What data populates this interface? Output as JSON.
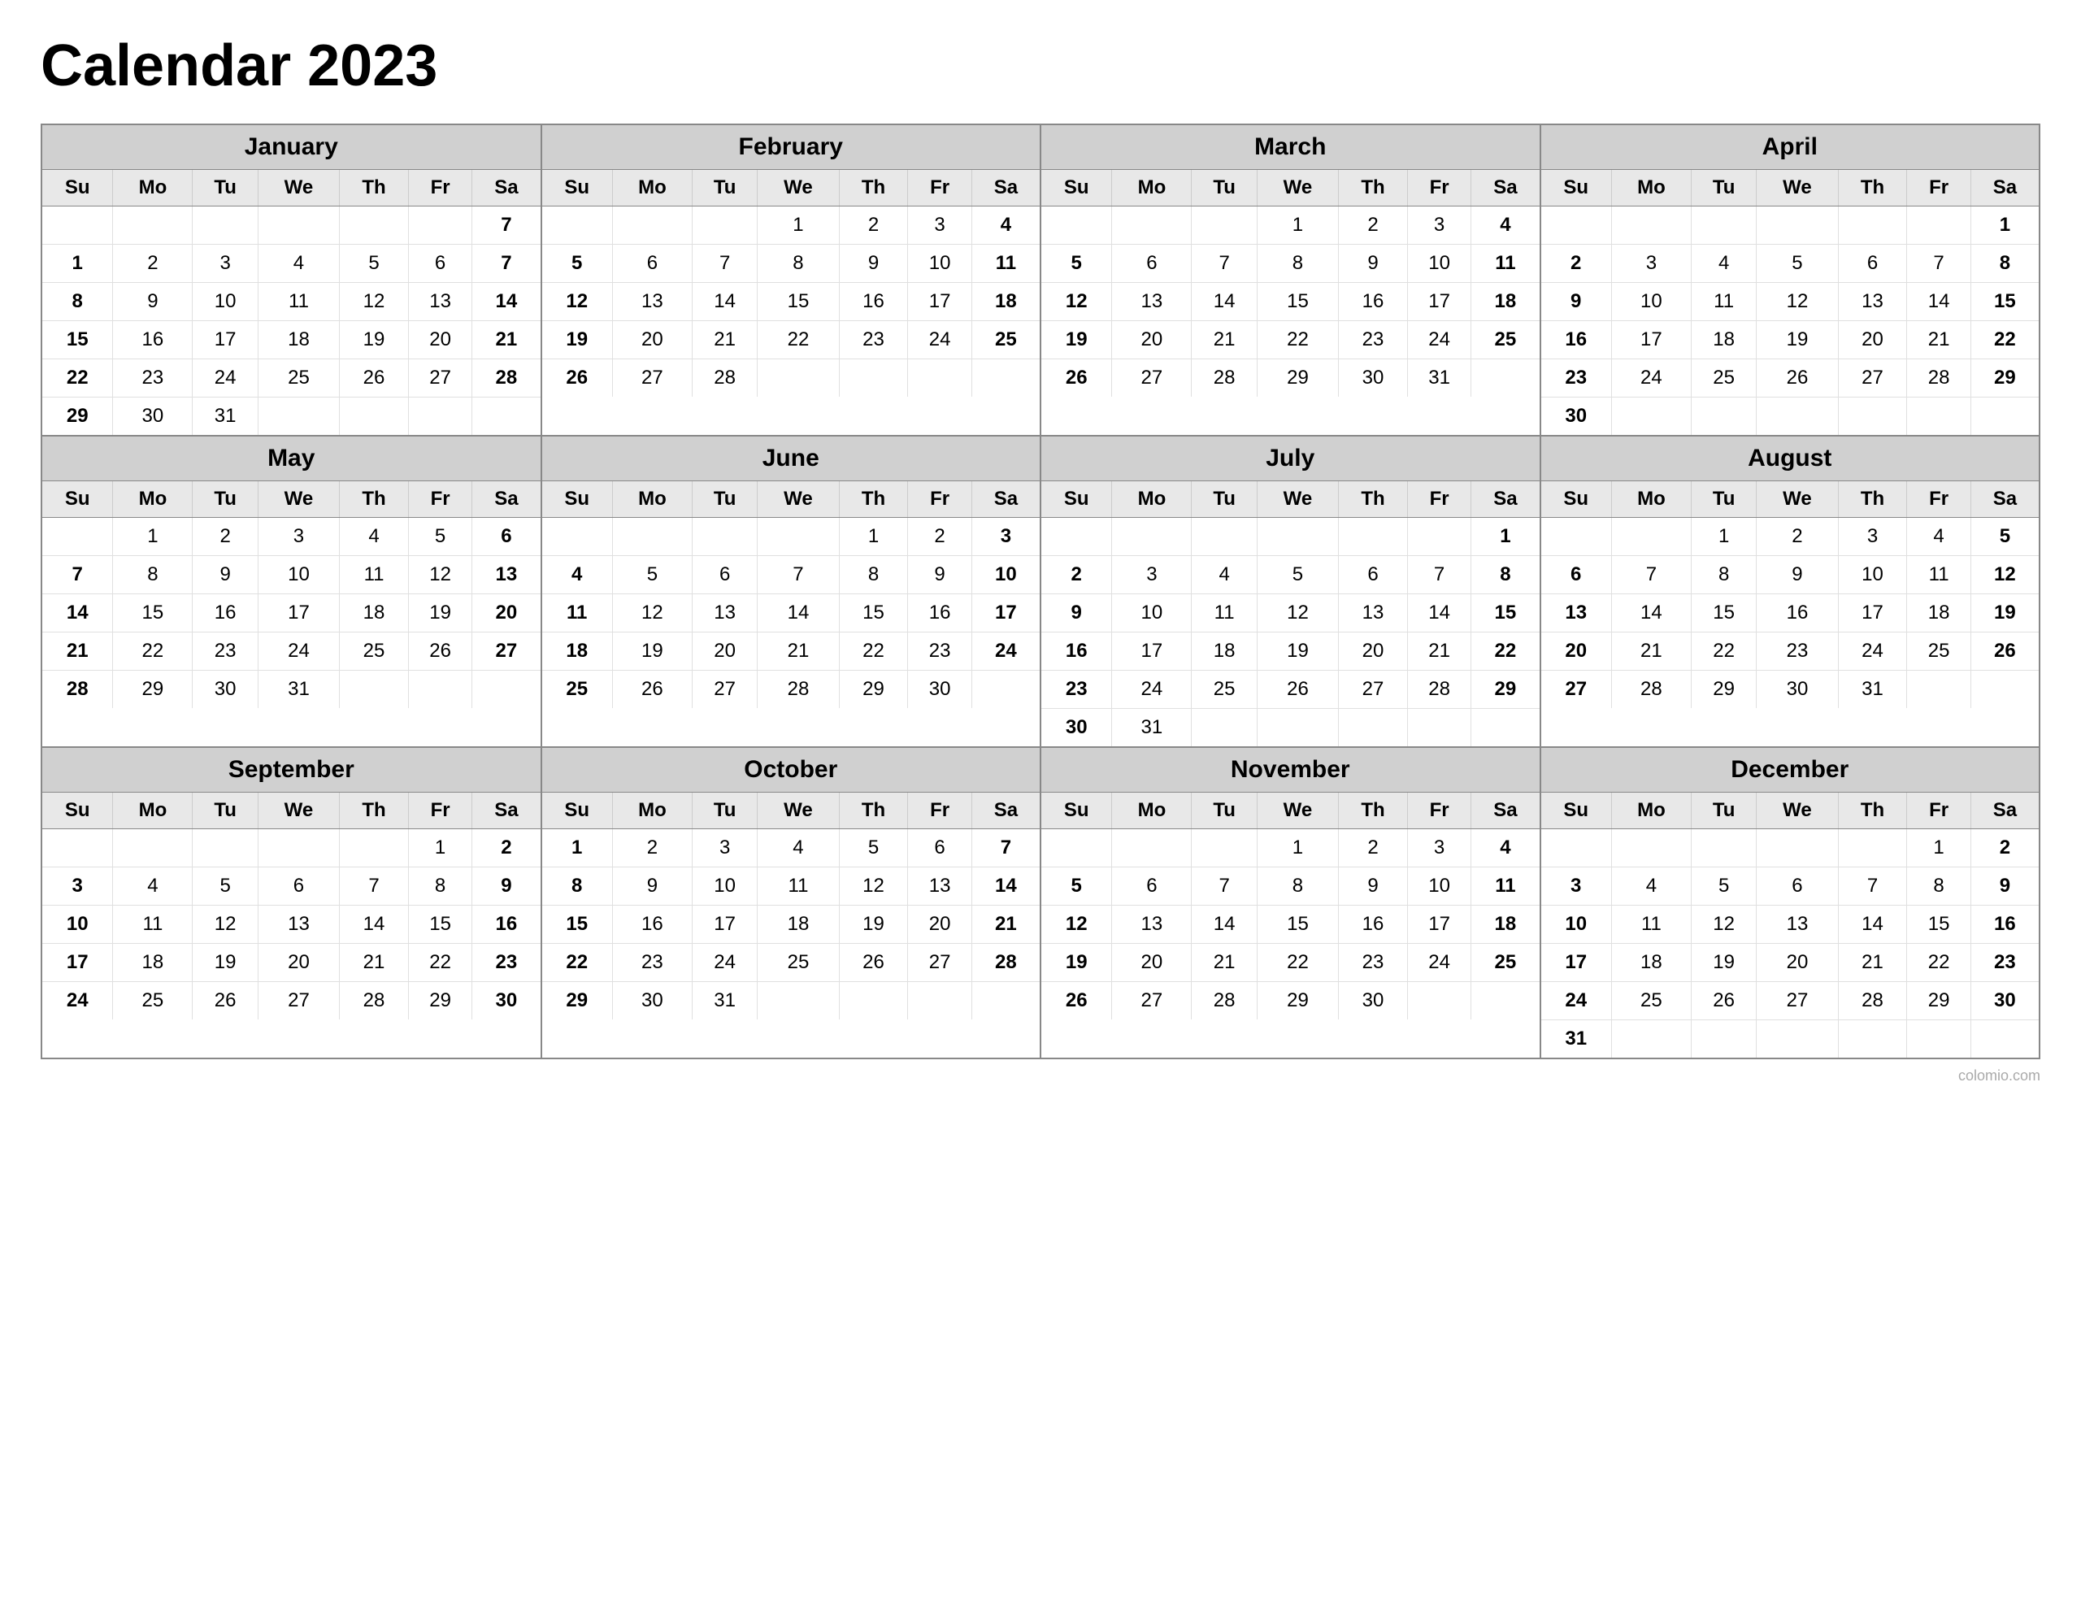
{
  "title": "Calendar 2023",
  "watermark": "colomio.com",
  "months": [
    {
      "name": "January",
      "days": [
        [
          "",
          "",
          "",
          "",
          "",
          "",
          "7"
        ],
        [
          "1",
          "2",
          "3",
          "4",
          "5",
          "6",
          "7"
        ],
        [
          "8",
          "9",
          "10",
          "11",
          "12",
          "13",
          "14"
        ],
        [
          "15",
          "16",
          "17",
          "18",
          "19",
          "20",
          "21"
        ],
        [
          "22",
          "23",
          "24",
          "25",
          "26",
          "27",
          "28"
        ],
        [
          "29",
          "30",
          "31",
          "",
          "",
          "",
          ""
        ]
      ],
      "startDay": 0
    },
    {
      "name": "February",
      "days": [
        [
          "",
          "",
          "",
          "1",
          "2",
          "3",
          "4"
        ],
        [
          "5",
          "6",
          "7",
          "8",
          "9",
          "10",
          "11"
        ],
        [
          "12",
          "13",
          "14",
          "15",
          "16",
          "17",
          "18"
        ],
        [
          "19",
          "20",
          "21",
          "22",
          "23",
          "24",
          "25"
        ],
        [
          "26",
          "27",
          "28",
          "",
          "",
          "",
          ""
        ]
      ],
      "startDay": 3
    },
    {
      "name": "March",
      "days": [
        [
          "",
          "",
          "",
          "1",
          "2",
          "3",
          "4"
        ],
        [
          "5",
          "6",
          "7",
          "8",
          "9",
          "10",
          "11"
        ],
        [
          "12",
          "13",
          "14",
          "15",
          "16",
          "17",
          "18"
        ],
        [
          "19",
          "20",
          "21",
          "22",
          "23",
          "24",
          "25"
        ],
        [
          "26",
          "27",
          "28",
          "29",
          "30",
          "31",
          ""
        ]
      ],
      "startDay": 3
    },
    {
      "name": "April",
      "days": [
        [
          "",
          "",
          "",
          "",
          "",
          "",
          "1"
        ],
        [
          "2",
          "3",
          "4",
          "5",
          "6",
          "7",
          "8"
        ],
        [
          "9",
          "10",
          "11",
          "12",
          "13",
          "14",
          "15"
        ],
        [
          "16",
          "17",
          "18",
          "19",
          "20",
          "21",
          "22"
        ],
        [
          "23",
          "24",
          "25",
          "26",
          "27",
          "28",
          "29"
        ],
        [
          "30",
          "",
          "",
          "",
          "",
          "",
          ""
        ]
      ],
      "startDay": 6
    },
    {
      "name": "May",
      "days": [
        [
          "",
          "1",
          "2",
          "3",
          "4",
          "5",
          "6"
        ],
        [
          "7",
          "8",
          "9",
          "10",
          "11",
          "12",
          "13"
        ],
        [
          "14",
          "15",
          "16",
          "17",
          "18",
          "19",
          "20"
        ],
        [
          "21",
          "22",
          "23",
          "24",
          "25",
          "26",
          "27"
        ],
        [
          "28",
          "29",
          "30",
          "31",
          "",
          "",
          ""
        ]
      ],
      "startDay": 1
    },
    {
      "name": "June",
      "days": [
        [
          "",
          "",
          "",
          "",
          "1",
          "2",
          "3"
        ],
        [
          "4",
          "5",
          "6",
          "7",
          "8",
          "9",
          "10"
        ],
        [
          "11",
          "12",
          "13",
          "14",
          "15",
          "16",
          "17"
        ],
        [
          "18",
          "19",
          "20",
          "21",
          "22",
          "23",
          "24"
        ],
        [
          "25",
          "26",
          "27",
          "28",
          "29",
          "30",
          ""
        ]
      ],
      "startDay": 4
    },
    {
      "name": "July",
      "days": [
        [
          "",
          "",
          "",
          "",
          "",
          "",
          "1"
        ],
        [
          "2",
          "3",
          "4",
          "5",
          "6",
          "7",
          "8"
        ],
        [
          "9",
          "10",
          "11",
          "12",
          "13",
          "14",
          "15"
        ],
        [
          "16",
          "17",
          "18",
          "19",
          "20",
          "21",
          "22"
        ],
        [
          "23",
          "24",
          "25",
          "26",
          "27",
          "28",
          "29"
        ],
        [
          "30",
          "31",
          "",
          "",
          "",
          "",
          ""
        ]
      ],
      "startDay": 6
    },
    {
      "name": "August",
      "days": [
        [
          "",
          "",
          "1",
          "2",
          "3",
          "4",
          "5"
        ],
        [
          "6",
          "7",
          "8",
          "9",
          "10",
          "11",
          "12"
        ],
        [
          "13",
          "14",
          "15",
          "16",
          "17",
          "18",
          "19"
        ],
        [
          "20",
          "21",
          "22",
          "23",
          "24",
          "25",
          "26"
        ],
        [
          "27",
          "28",
          "29",
          "30",
          "31",
          "",
          ""
        ]
      ],
      "startDay": 2
    },
    {
      "name": "September",
      "days": [
        [
          "",
          "",
          "",
          "",
          "",
          "1",
          "2"
        ],
        [
          "3",
          "4",
          "5",
          "6",
          "7",
          "8",
          "9"
        ],
        [
          "10",
          "11",
          "12",
          "13",
          "14",
          "15",
          "16"
        ],
        [
          "17",
          "18",
          "19",
          "20",
          "21",
          "22",
          "23"
        ],
        [
          "24",
          "25",
          "26",
          "27",
          "28",
          "29",
          "30"
        ]
      ],
      "startDay": 5
    },
    {
      "name": "October",
      "days": [
        [
          "1",
          "2",
          "3",
          "4",
          "5",
          "6",
          "7"
        ],
        [
          "8",
          "9",
          "10",
          "11",
          "12",
          "13",
          "14"
        ],
        [
          "15",
          "16",
          "17",
          "18",
          "19",
          "20",
          "21"
        ],
        [
          "22",
          "23",
          "24",
          "25",
          "26",
          "27",
          "28"
        ],
        [
          "29",
          "30",
          "31",
          "",
          "",
          "",
          ""
        ]
      ],
      "startDay": 0
    },
    {
      "name": "November",
      "days": [
        [
          "",
          "",
          "",
          "1",
          "2",
          "3",
          "4"
        ],
        [
          "5",
          "6",
          "7",
          "8",
          "9",
          "10",
          "11"
        ],
        [
          "12",
          "13",
          "14",
          "15",
          "16",
          "17",
          "18"
        ],
        [
          "19",
          "20",
          "21",
          "22",
          "23",
          "24",
          "25"
        ],
        [
          "26",
          "27",
          "28",
          "29",
          "30",
          "",
          ""
        ]
      ],
      "startDay": 3
    },
    {
      "name": "December",
      "days": [
        [
          "",
          "",
          "",
          "",
          "",
          "1",
          "2"
        ],
        [
          "3",
          "4",
          "5",
          "6",
          "7",
          "8",
          "9"
        ],
        [
          "10",
          "11",
          "12",
          "13",
          "14",
          "15",
          "16"
        ],
        [
          "17",
          "18",
          "19",
          "20",
          "21",
          "22",
          "23"
        ],
        [
          "24",
          "25",
          "26",
          "27",
          "28",
          "29",
          "30"
        ],
        [
          "31",
          "",
          "",
          "",
          "",
          "",
          ""
        ]
      ],
      "startDay": 5
    }
  ],
  "weekdays": [
    "Su",
    "Mo",
    "Tu",
    "We",
    "Th",
    "Fr",
    "Sa"
  ]
}
